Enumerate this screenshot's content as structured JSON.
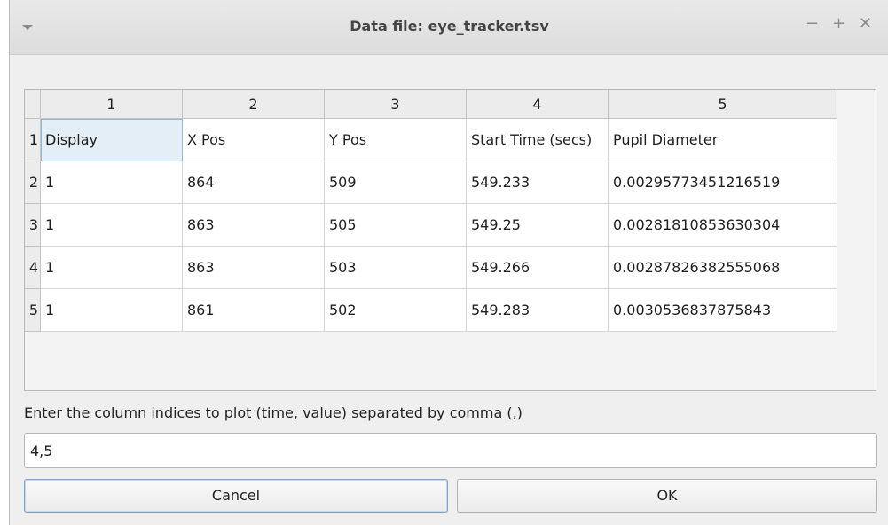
{
  "window": {
    "title": "Data file: eye_tracker.tsv"
  },
  "titlebar_icons": {
    "menu": "chevron-down-icon",
    "minimize": "minimize-icon",
    "maximize": "maximize-icon",
    "close": "close-icon"
  },
  "window_controls": {
    "minimize": "−",
    "maximize": "+",
    "close": "✕"
  },
  "table": {
    "column_headers": [
      "1",
      "2",
      "3",
      "4",
      "5"
    ],
    "row_headers": [
      "1",
      "2",
      "3",
      "4",
      "5"
    ],
    "rows": [
      [
        "Display",
        "X Pos",
        "Y Pos",
        "Start Time (secs)",
        "Pupil Diameter"
      ],
      [
        "1",
        "864",
        "509",
        "549.233",
        "0.00295773451216519"
      ],
      [
        "1",
        "863",
        "505",
        "549.25",
        "0.00281810853630304"
      ],
      [
        "1",
        "863",
        "503",
        "549.266",
        "0.00287826382555068"
      ],
      [
        "1",
        "861",
        "502",
        "549.283",
        "0.0030536837875843"
      ]
    ]
  },
  "prompt": {
    "label": "Enter the column indices to plot (time, value) separated by comma (,)",
    "value": "4,5"
  },
  "buttons": {
    "cancel": "Cancel",
    "ok": "OK"
  }
}
